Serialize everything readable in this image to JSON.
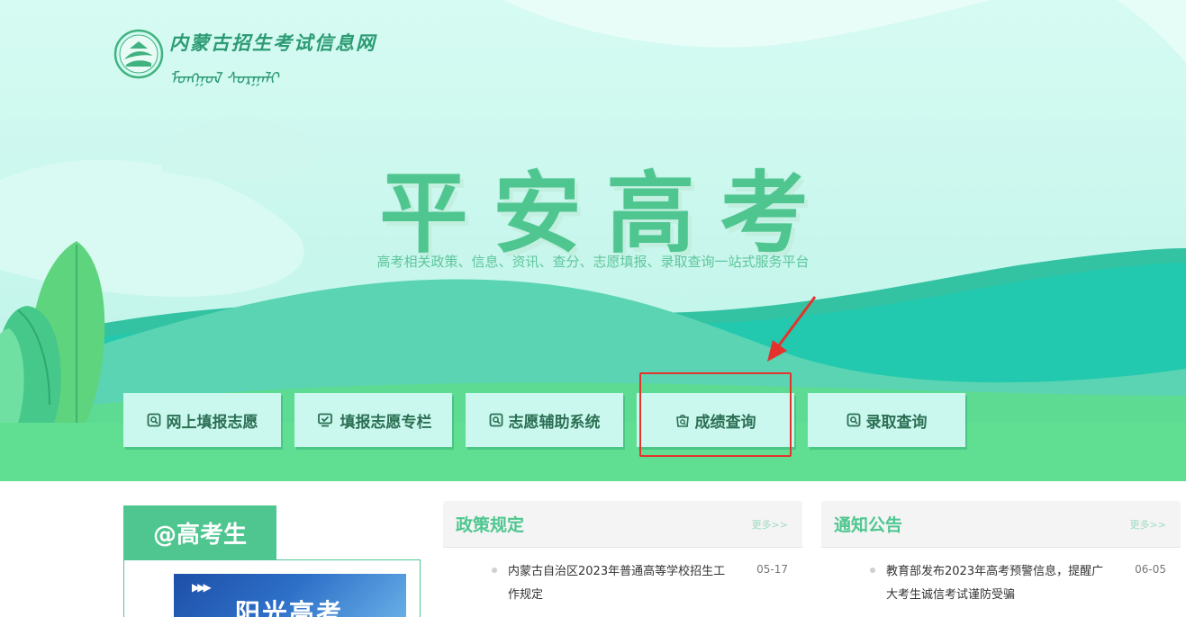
{
  "site": {
    "logo_cn": "内蒙古招生考试信息网",
    "logo_mn": "ᠮᠣᠩᠭᠣᠯ ᠰᠤᠷᠭᠠᠯᠢ"
  },
  "hero": {
    "slogan": "平安高考",
    "subline": "高考相关政策、信息、资讯、查分、志愿填报、录取查询一站式服务平台"
  },
  "quick_links": [
    {
      "label": "网上填报志愿",
      "icon": "doc-search-icon"
    },
    {
      "label": "填报志愿专栏",
      "icon": "monitor-check-icon"
    },
    {
      "label": "志愿辅助系统",
      "icon": "doc-search-icon"
    },
    {
      "label": "成绩查询",
      "icon": "bag-search-icon"
    },
    {
      "label": "录取查询",
      "icon": "doc-search-icon"
    }
  ],
  "student_card": {
    "tab_label": "@高考生",
    "banner_arrows": "▶▶▶",
    "banner_title": "阳光高考"
  },
  "policy_panel": {
    "title": "政策规定",
    "more": "更多>>",
    "items": [
      {
        "text": "内蒙古自治区2023年普通高等学校招生工作规定",
        "date": "05-17"
      }
    ]
  },
  "notice_panel": {
    "title": "通知公告",
    "more": "更多>>",
    "items": [
      {
        "text": "教育部发布2023年高考预警信息，提醒广大考生诚信考试谨防受骗",
        "date": "06-05"
      }
    ]
  },
  "colors": {
    "brand_green": "#4fc690",
    "highlight_red": "#e5322c"
  }
}
